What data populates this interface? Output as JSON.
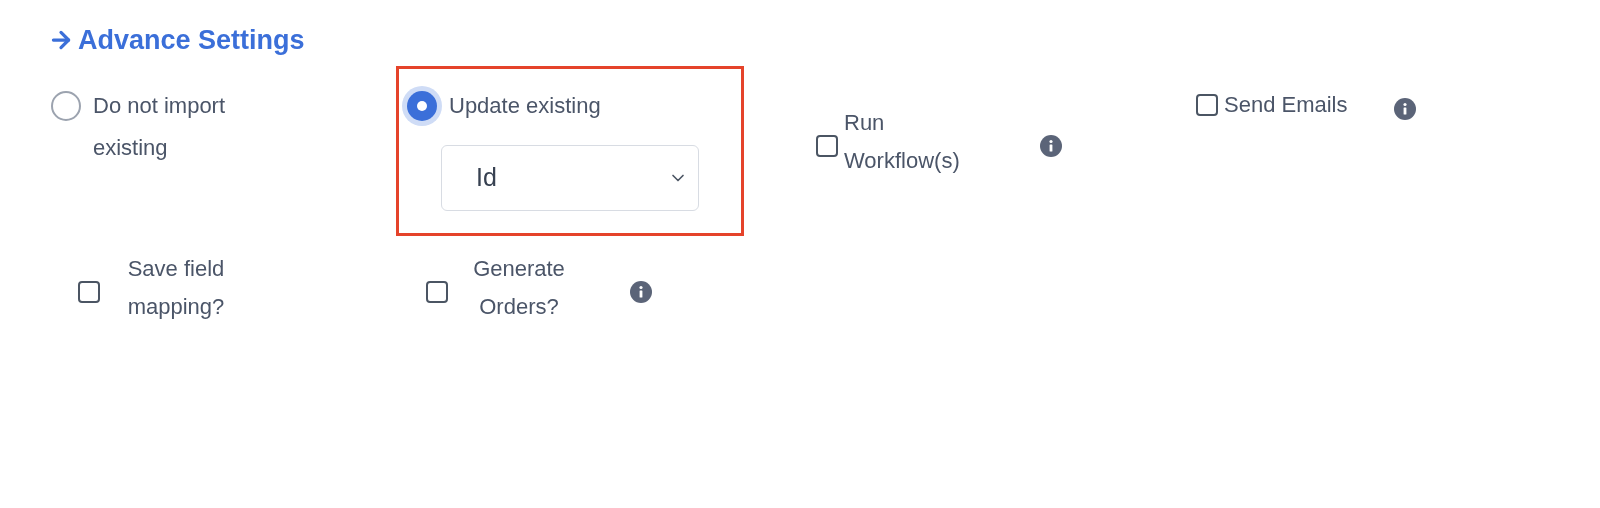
{
  "title": "Advance Settings",
  "import_mode": [
    {
      "label": "Do not import existing",
      "selected": false,
      "highlighted": false
    },
    {
      "label": "Update existing",
      "selected": true,
      "highlighted": true,
      "match_field": {
        "value": "Id"
      }
    }
  ],
  "options": [
    {
      "label": "Run Workflow(s)",
      "checked": false,
      "info": true
    },
    {
      "label": "Send Emails",
      "checked": false,
      "info": true
    },
    {
      "label": "Save field mapping?",
      "checked": false,
      "info": false
    },
    {
      "label": "Generate Orders?",
      "checked": false,
      "info": true
    }
  ]
}
